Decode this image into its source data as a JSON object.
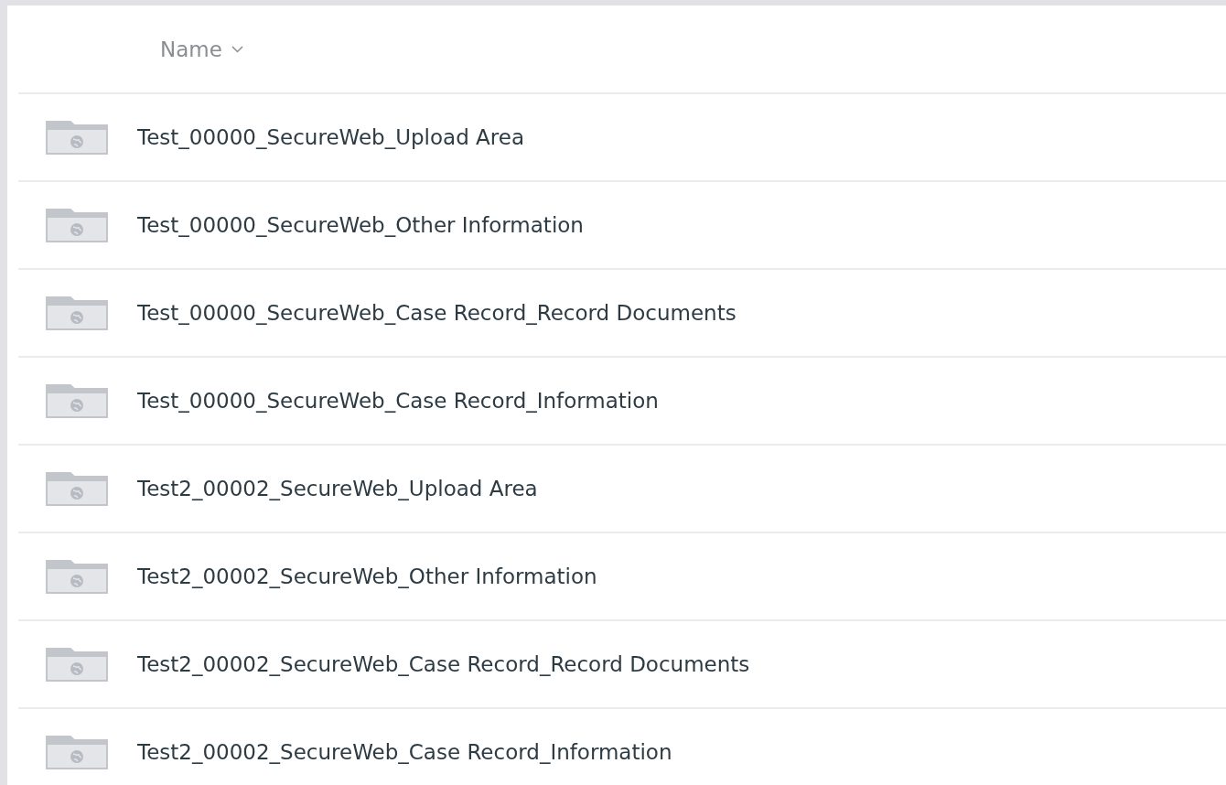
{
  "table": {
    "columns": [
      {
        "label": "Name",
        "sort_descending": true
      }
    ],
    "rows": [
      {
        "name": "Test_00000_SecureWeb_Upload Area"
      },
      {
        "name": "Test_00000_SecureWeb_Other Information"
      },
      {
        "name": "Test_00000_SecureWeb_Case Record_Record Documents"
      },
      {
        "name": "Test_00000_SecureWeb_Case Record_Information"
      },
      {
        "name": "Test2_00002_SecureWeb_Upload Area"
      },
      {
        "name": "Test2_00002_SecureWeb_Other Information"
      },
      {
        "name": "Test2_00002_SecureWeb_Case Record_Record Documents"
      },
      {
        "name": "Test2_00002_SecureWeb_Case Record_Information"
      }
    ]
  }
}
